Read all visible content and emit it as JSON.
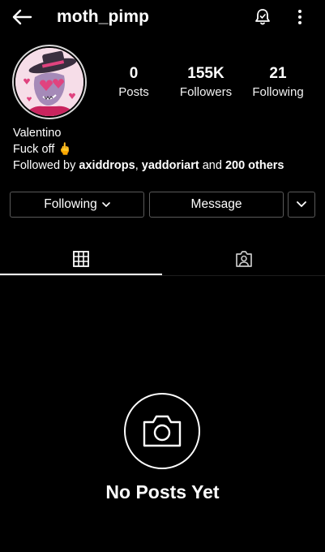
{
  "topbar": {
    "username": "moth_pimp"
  },
  "profile": {
    "stats": [
      {
        "value": "0",
        "label": "Posts"
      },
      {
        "value": "155K",
        "label": "Followers"
      },
      {
        "value": "21",
        "label": "Following"
      }
    ],
    "name": "Valentino",
    "bio_text": "Fuck off",
    "bio_emoji": "🖕",
    "followed_by_prefix": "Followed by",
    "followed_by_user1": "axiddrops",
    "followed_by_sep": ",",
    "followed_by_user2": "yaddoriart",
    "followed_by_and": "and",
    "followed_by_others": "200 others"
  },
  "actions": {
    "following_label": "Following",
    "message_label": "Message"
  },
  "tabs": [
    {
      "icon": "grid-icon"
    },
    {
      "icon": "tagged-person-icon"
    }
  ],
  "empty_state": {
    "icon": "camera-icon",
    "title": "No Posts Yet"
  },
  "colors": {
    "background": "#000000",
    "text": "#ffffff",
    "button_border": "#5a5a5a",
    "avatar_accent": "#e0437f"
  }
}
